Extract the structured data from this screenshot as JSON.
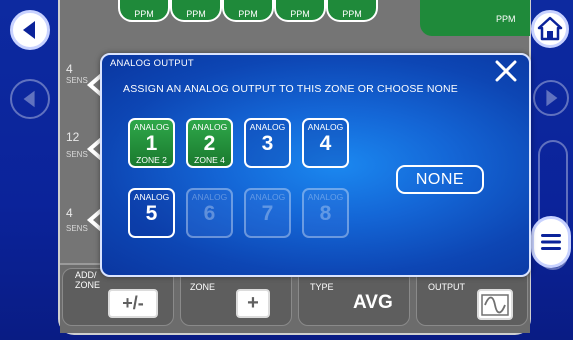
{
  "background": {
    "ppm_pills": [
      "PPM",
      "PPM",
      "PPM",
      "PPM",
      "PPM"
    ],
    "main_display_unit": "PPM",
    "sensor_rows": [
      {
        "count": "4",
        "label": "SENS"
      },
      {
        "count": "12",
        "label": "SENS"
      },
      {
        "count": "4",
        "label": "SENS"
      }
    ],
    "colors": {
      "panel": "#757575",
      "display_green": "#1f8a3a"
    }
  },
  "bottom_bar": {
    "add_zone_label": "ADD/\nZONE",
    "add_zone_button": "+/-",
    "zone_label": "ZONE",
    "zone_button": "+",
    "type_label": "TYPE",
    "type_value": "AVG",
    "output_label": "OUTPUT"
  },
  "modal": {
    "title": "ANALOG OUTPUT",
    "instruction": "ASSIGN AN ANALOG OUTPUT TO THIS ZONE OR CHOOSE NONE",
    "outputs": [
      {
        "header": "ANALOG",
        "number": "1",
        "zone": "ZONE 2",
        "state": "assigned"
      },
      {
        "header": "ANALOG",
        "number": "2",
        "zone": "ZONE 4",
        "state": "assigned"
      },
      {
        "header": "ANALOG",
        "number": "3",
        "zone": "",
        "state": "available"
      },
      {
        "header": "ANALOG",
        "number": "4",
        "zone": "",
        "state": "available"
      },
      {
        "header": "ANALOG",
        "number": "5",
        "zone": "",
        "state": "available"
      },
      {
        "header": "ANALOG",
        "number": "6",
        "zone": "",
        "state": "disabled"
      },
      {
        "header": "ANALOG",
        "number": "7",
        "zone": "",
        "state": "disabled"
      },
      {
        "header": "ANALOG",
        "number": "8",
        "zone": "",
        "state": "disabled"
      }
    ],
    "none_label": "NONE",
    "colors": {
      "assigned": "#1f8a3a",
      "accent": "#1466d6"
    }
  },
  "icons": {
    "back": "back-arrow-icon",
    "home": "home-icon",
    "menu": "hamburger-menu-icon",
    "close": "close-icon",
    "waveform": "sine-wave-icon"
  }
}
